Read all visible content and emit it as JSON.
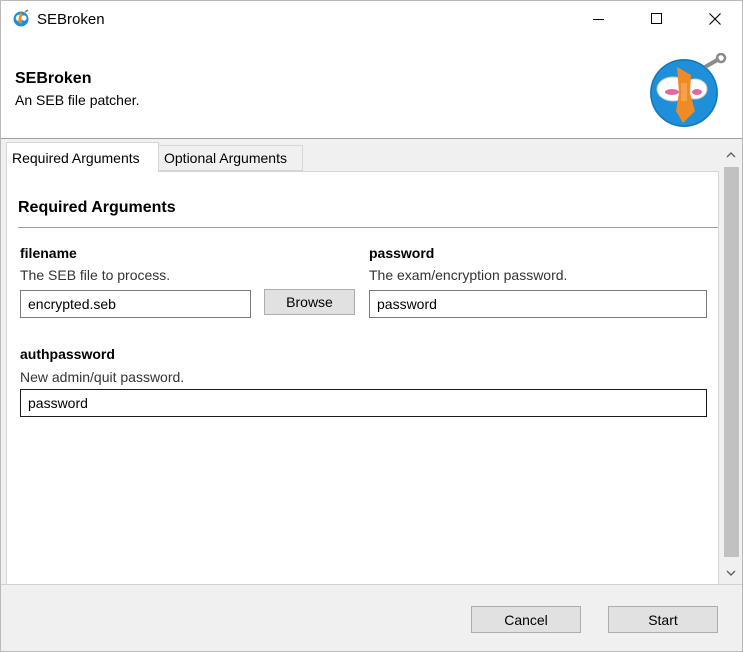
{
  "window": {
    "title": "SEBroken",
    "icon": "sebroken-app-icon",
    "controls": {
      "minimize": "minimize-icon",
      "maximize": "maximize-icon",
      "close": "close-icon"
    }
  },
  "header": {
    "title": "SEBroken",
    "subtitle": "An SEB file patcher.",
    "logo": "sebroken-logo"
  },
  "tabs": [
    {
      "label": "Required Arguments",
      "selected": true
    },
    {
      "label": "Optional Arguments",
      "selected": false
    }
  ],
  "section": {
    "title": "Required Arguments"
  },
  "arguments": {
    "filename": {
      "name": "filename",
      "description": "The SEB file to process.",
      "value": "encrypted.seb",
      "browse_label": "Browse"
    },
    "password": {
      "name": "password",
      "description": "The exam/encryption password.",
      "value": "password"
    },
    "authpassword": {
      "name": "authpassword",
      "description": "New admin/quit password.",
      "value": "password"
    }
  },
  "footer": {
    "cancel_label": "Cancel",
    "start_label": "Start"
  },
  "colors": {
    "accent_blue": "#1e8fd8",
    "orange": "#f08a24",
    "button_face": "#e1e1e1",
    "panel_bg": "#f0f0f0"
  }
}
